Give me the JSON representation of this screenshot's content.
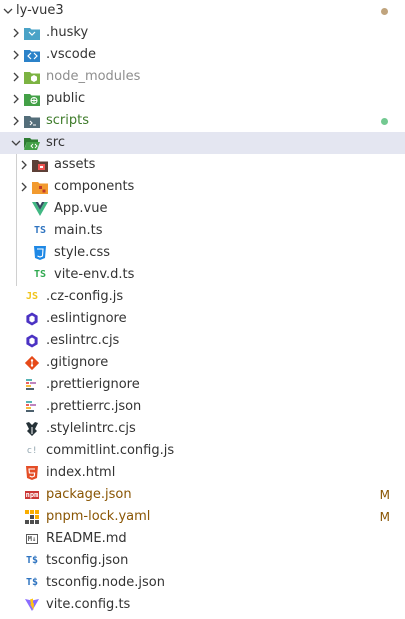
{
  "explorer": {
    "root": {
      "label": "ly-vue3",
      "status_dot_color": "#c0a47d"
    },
    "folders": {
      "husky": ".husky",
      "vscode": ".vscode",
      "node_modules": "node_modules",
      "public": "public",
      "scripts": "scripts",
      "src": "src",
      "assets": "assets",
      "components": "components"
    },
    "files": {
      "app_vue": "App.vue",
      "main_ts": "main.ts",
      "style_css": "style.css",
      "vite_env": "vite-env.d.ts",
      "cz_config": ".cz-config.js",
      "eslintignore": ".eslintignore",
      "eslintrc": ".eslintrc.cjs",
      "gitignore": ".gitignore",
      "prettierignore": ".prettierignore",
      "prettierrc": ".prettierrc.json",
      "stylelintrc": ".stylelintrc.cjs",
      "commitlint": "commitlint.config.js",
      "index_html": "index.html",
      "package_json": "package.json",
      "pnpm_lock": "pnpm-lock.yaml",
      "readme": "README.md",
      "tsconfig": "tsconfig.json",
      "tsconfig_node": "tsconfig.node.json",
      "vite_config": "vite.config.ts"
    },
    "badges": {
      "package_json": "M",
      "pnpm_lock": "M"
    },
    "icons": {
      "ts_text": "TS",
      "js_text": "JS",
      "ts_config_text": "T$",
      "md_text": "M↓",
      "npm_text": "npm",
      "commitlint_text": "c!"
    },
    "colors": {
      "untracked_green": "#73c991",
      "modified": "#895503",
      "selected_bg": "#e4e6f1"
    }
  }
}
